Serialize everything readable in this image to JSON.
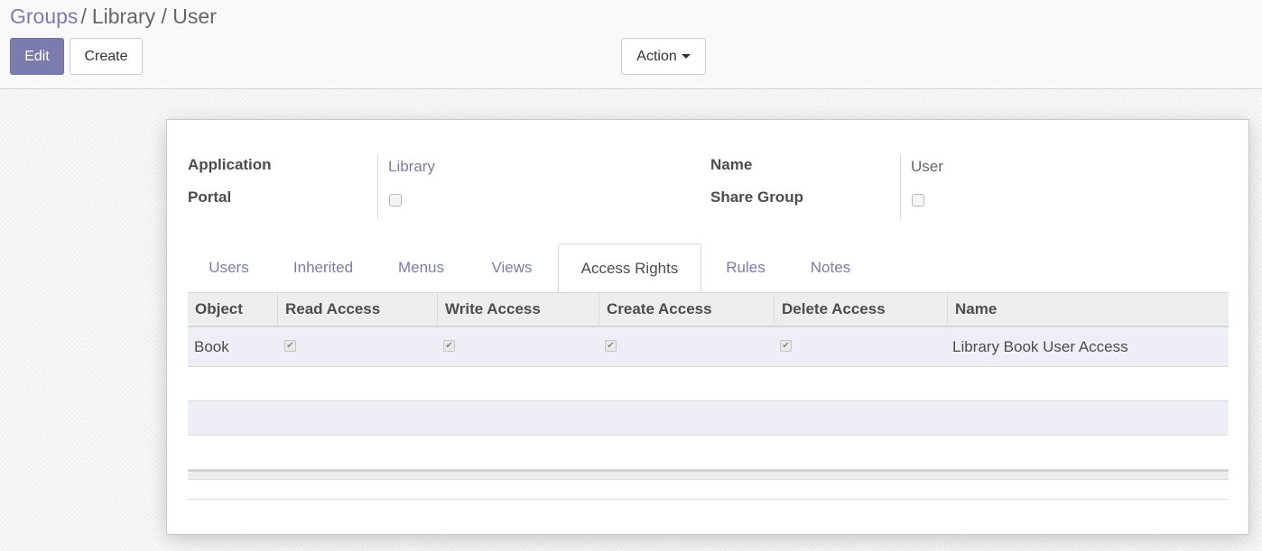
{
  "breadcrumb": {
    "parent": "Groups",
    "separator": "/",
    "current": "Library / User"
  },
  "toolbar": {
    "edit_label": "Edit",
    "create_label": "Create",
    "action_label": "Action"
  },
  "form": {
    "application_label": "Application",
    "application_value": "Library",
    "portal_label": "Portal",
    "portal_checked": false,
    "name_label": "Name",
    "name_value": "User",
    "share_group_label": "Share Group",
    "share_group_checked": false
  },
  "tabs": [
    {
      "label": "Users",
      "active": false
    },
    {
      "label": "Inherited",
      "active": false
    },
    {
      "label": "Menus",
      "active": false
    },
    {
      "label": "Views",
      "active": false
    },
    {
      "label": "Access Rights",
      "active": true
    },
    {
      "label": "Rules",
      "active": false
    },
    {
      "label": "Notes",
      "active": false
    }
  ],
  "access_table": {
    "columns": [
      "Object",
      "Read Access",
      "Write Access",
      "Create Access",
      "Delete Access",
      "Name"
    ],
    "rows": [
      {
        "object": "Book",
        "read": true,
        "write": true,
        "create": true,
        "delete": true,
        "name": "Library Book User Access"
      }
    ]
  },
  "colors": {
    "accent": "#7c7bad",
    "row_stripe": "#eeeef7",
    "header_bg": "#eeeeee"
  },
  "icons": {
    "check": "check-icon",
    "caret": "caret-down-icon"
  }
}
